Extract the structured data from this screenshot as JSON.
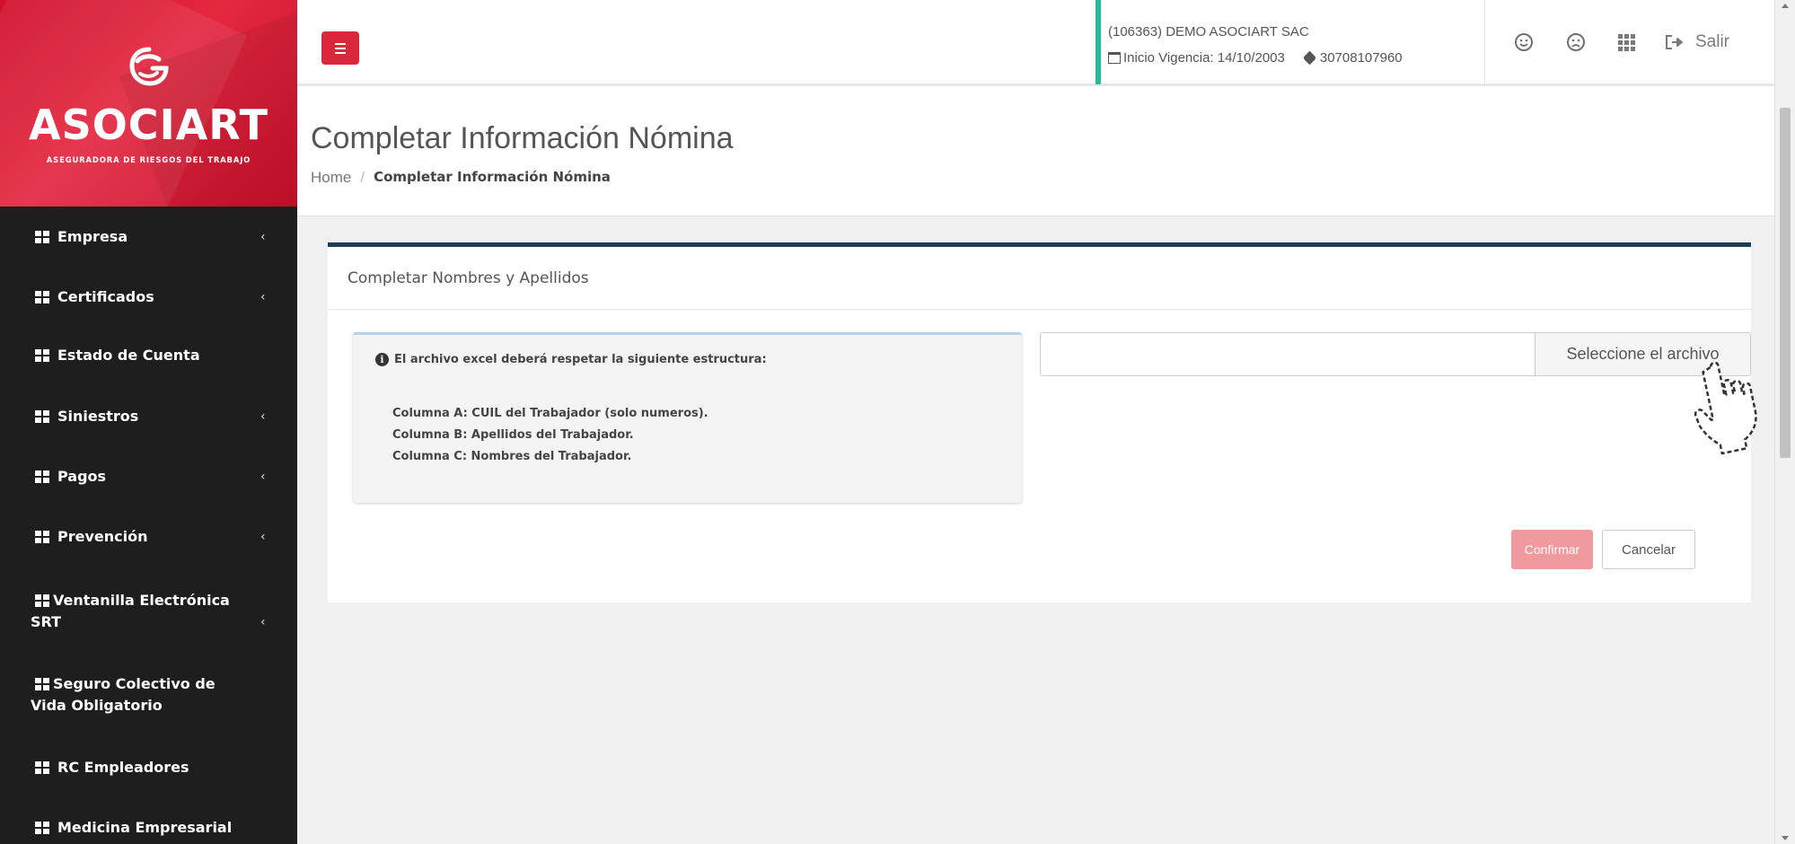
{
  "brand": {
    "name": "ASOCIART",
    "subtitle": "ASEGURADORA DE RIESGOS DEL TRABAJO",
    "logo_icon": "asociart-logo-icon",
    "color": "#d9273c"
  },
  "sidebar": {
    "items": [
      {
        "label": "Empresa",
        "chevron": "‹"
      },
      {
        "label": "Certificados",
        "chevron": "‹"
      },
      {
        "label": "Estado de Cuenta",
        "chevron": ""
      },
      {
        "label": "Siniestros",
        "chevron": "‹"
      },
      {
        "label": "Pagos",
        "chevron": "‹"
      },
      {
        "label": "Prevención",
        "chevron": "‹"
      },
      {
        "label": "Ventanilla Electrónica SRT",
        "chevron": "‹"
      },
      {
        "label": "Seguro Colectivo de Vida Obligatorio",
        "chevron": ""
      },
      {
        "label": "RC Empleadores",
        "chevron": ""
      },
      {
        "label": "Medicina Empresarial",
        "chevron": ""
      }
    ]
  },
  "topbar": {
    "menu_icon": "hamburger-icon",
    "company": {
      "name": "(106363) DEMO ASOCIART SAC",
      "vigencia": "Inicio Vigencia: 14/10/2003",
      "cuit": "30708107960"
    },
    "actions": {
      "happy_icon": "smile-icon",
      "sad_icon": "frown-icon",
      "apps_icon": "grid-icon",
      "logout_label": "Salir"
    }
  },
  "page": {
    "title": "Completar Información Nómina",
    "breadcrumb": {
      "home": "Home",
      "separator": "/",
      "current": "Completar Información Nómina"
    }
  },
  "card": {
    "title": "Completar Nombres y Apellidos",
    "info": {
      "heading": "El archivo excel deberá respetar la siguiente estructura:",
      "lines": [
        "Columna A: CUIL del Trabajador (solo numeros).",
        "Columna B: Apellidos del Trabajador.",
        "Columna C: Nombres del Trabajador."
      ]
    },
    "file_input": {
      "value": "",
      "button_label": "Seleccione el archivo"
    },
    "buttons": {
      "confirm": "Confirmar",
      "cancel": "Cancelar"
    }
  },
  "colors": {
    "sidebar_bg": "#1e1e1e",
    "accent_red": "#d9273c",
    "company_border": "#26b99a",
    "card_border": "#1f3d57",
    "confirm_disabled": "#f19a9e"
  }
}
